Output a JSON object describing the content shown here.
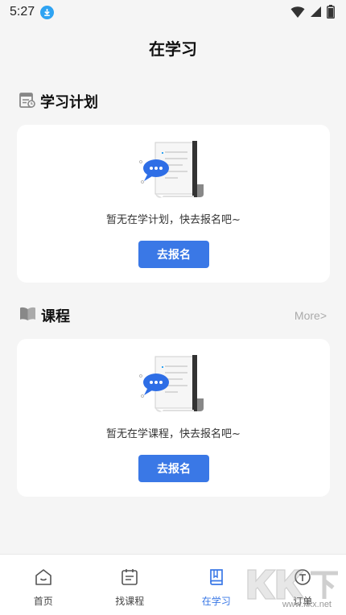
{
  "status_bar": {
    "time": "5:27"
  },
  "header": {
    "title": "在学习"
  },
  "study_plan": {
    "title": "学习计划",
    "empty_text": "暂无在学计划，快去报名吧~",
    "button_label": "去报名"
  },
  "courses": {
    "title": "课程",
    "more_label": "More>",
    "empty_text": "暂无在学课程，快去报名吧~",
    "button_label": "去报名"
  },
  "tab_bar": {
    "items": [
      {
        "label": "首页"
      },
      {
        "label": "找课程"
      },
      {
        "label": "在学习"
      },
      {
        "label": "订单"
      }
    ]
  },
  "watermark": {
    "brand": "KK下载",
    "url": "www.kkx.net"
  },
  "colors": {
    "accent": "#3a78e6",
    "background": "#f5f5f5"
  }
}
